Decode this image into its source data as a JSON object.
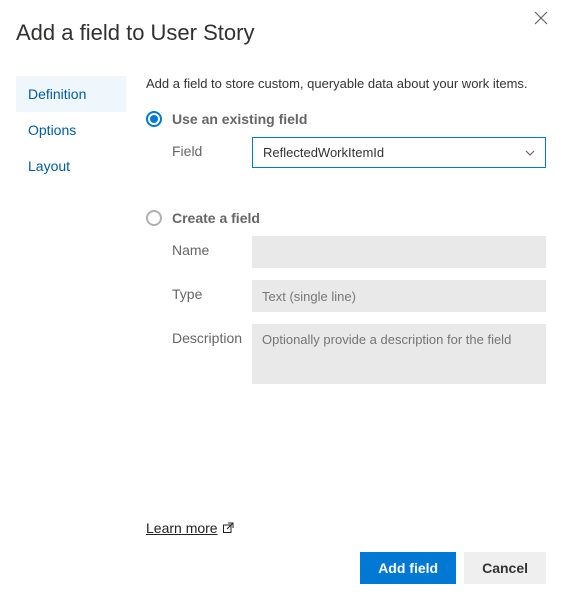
{
  "dialog": {
    "title": "Add a field to User Story",
    "intro": "Add a field to store custom, queryable data about your work items."
  },
  "sidebar": {
    "items": [
      {
        "label": "Definition",
        "active": true
      },
      {
        "label": "Options",
        "active": false
      },
      {
        "label": "Layout",
        "active": false
      }
    ]
  },
  "existing": {
    "radio_label": "Use an existing field",
    "field_label": "Field",
    "field_value": "ReflectedWorkItemId"
  },
  "create": {
    "radio_label": "Create a field",
    "name_label": "Name",
    "name_value": "",
    "type_label": "Type",
    "type_value": "Text (single line)",
    "desc_label": "Description",
    "desc_placeholder": "Optionally provide a description for the field"
  },
  "learn_more": "Learn more",
  "footer": {
    "primary": "Add field",
    "cancel": "Cancel"
  }
}
